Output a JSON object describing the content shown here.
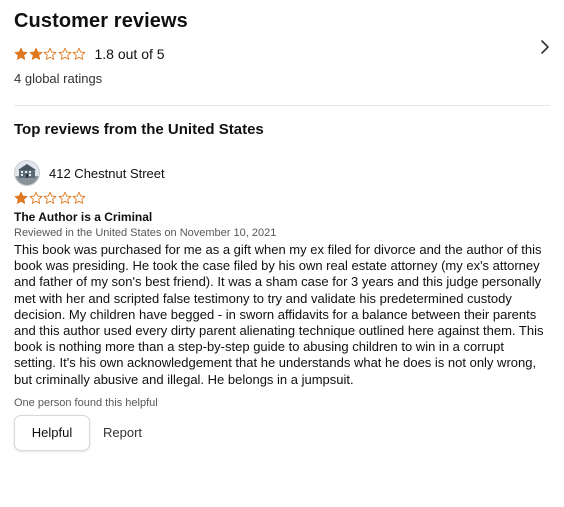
{
  "header": {
    "title": "Customer reviews",
    "rating_text": "1.8 out of 5",
    "rating_value": 1.8,
    "ratings_count": "4 global ratings",
    "star_color": "#de7921"
  },
  "top_reviews": {
    "title": "Top reviews from the United States"
  },
  "review": {
    "profile_name": "412 Chestnut Street",
    "stars": 1,
    "title": "The Author is a Criminal",
    "date": "Reviewed in the United States on November 10, 2021",
    "body": "This book was purchased for me as a gift when my ex filed for divorce and the author of this book was presiding. He took the case filed by his own real estate attorney (my ex's attorney and father of my son's best friend). It was a sham case for 3 years and this judge personally met with her and scripted false testimony to try and validate his predetermined custody decision. My children have begged - in sworn affidavits for a balance between their parents and this author used every dirty parent alienating technique outlined here against them. This book is nothing more than a step-by-step guide to abusing children to win in a corrupt setting. It's his own acknowledgement that he understands what he does is not only wrong, but criminally abusive and illegal. He belongs in a jumpsuit.",
    "helpful_count": "One person found this helpful",
    "helpful_label": "Helpful",
    "report_label": "Report"
  }
}
